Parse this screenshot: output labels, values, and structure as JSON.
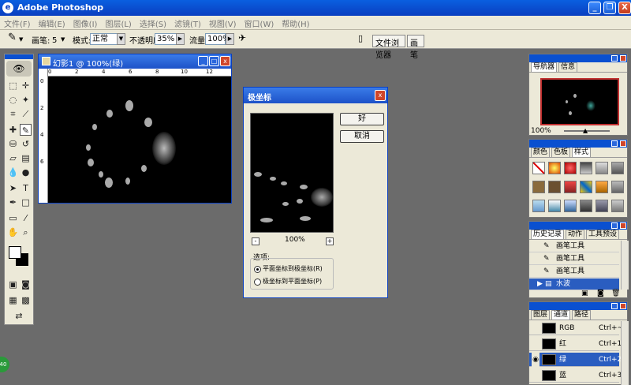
{
  "app": {
    "title": "Adobe Photoshop"
  },
  "menu": [
    "文件(F)",
    "编辑(E)",
    "图像(I)",
    "图层(L)",
    "选择(S)",
    "滤镜(T)",
    "视图(V)",
    "窗口(W)",
    "帮助(H)"
  ],
  "options": {
    "brush_label": "画笔:",
    "brush_size": "5",
    "mode_label": "模式:",
    "mode_value": "正常",
    "opacity_label": "不透明度:",
    "opacity_value": "35%",
    "flow_label": "流量:",
    "flow_value": "100%",
    "tab_file_browser": "文件浏览器",
    "tab_brushes": "画笔"
  },
  "document": {
    "title": "幻影1 @ 100%(绿)",
    "ruler_h": [
      "0",
      "2",
      "4",
      "6",
      "8",
      "10",
      "12"
    ],
    "ruler_v": [
      "0",
      "2",
      "4",
      "6"
    ]
  },
  "dialog": {
    "title": "极坐标",
    "ok": "好",
    "cancel": "取消",
    "zoom": "100%",
    "options_label": "选项:",
    "option1": "平面坐标到极坐标(R)",
    "option2": "极坐标到平面坐标(P)",
    "selected": 1
  },
  "navigator": {
    "tab1": "导航器",
    "tab2": "信息",
    "zoom": "100%"
  },
  "swatches": {
    "tab1": "颜色",
    "tab2": "色板",
    "tab3": "样式"
  },
  "history": {
    "tab1": "历史记录",
    "tab2": "动作",
    "tab3": "工具预设",
    "items": [
      "画笔工具",
      "画笔工具",
      "画笔工具",
      "水波"
    ]
  },
  "channels": {
    "tab1": "图层",
    "tab2": "通道",
    "tab3": "路径",
    "rows": [
      {
        "name": "RGB",
        "shortcut": "Ctrl+~"
      },
      {
        "name": "红",
        "shortcut": "Ctrl+1"
      },
      {
        "name": "绿",
        "shortcut": "Ctrl+2"
      },
      {
        "name": "蓝",
        "shortcut": "Ctrl+3"
      }
    ]
  },
  "badge": "40",
  "colors": {
    "accent": "#2a5dc0",
    "workspace": "#6b6b6b"
  }
}
